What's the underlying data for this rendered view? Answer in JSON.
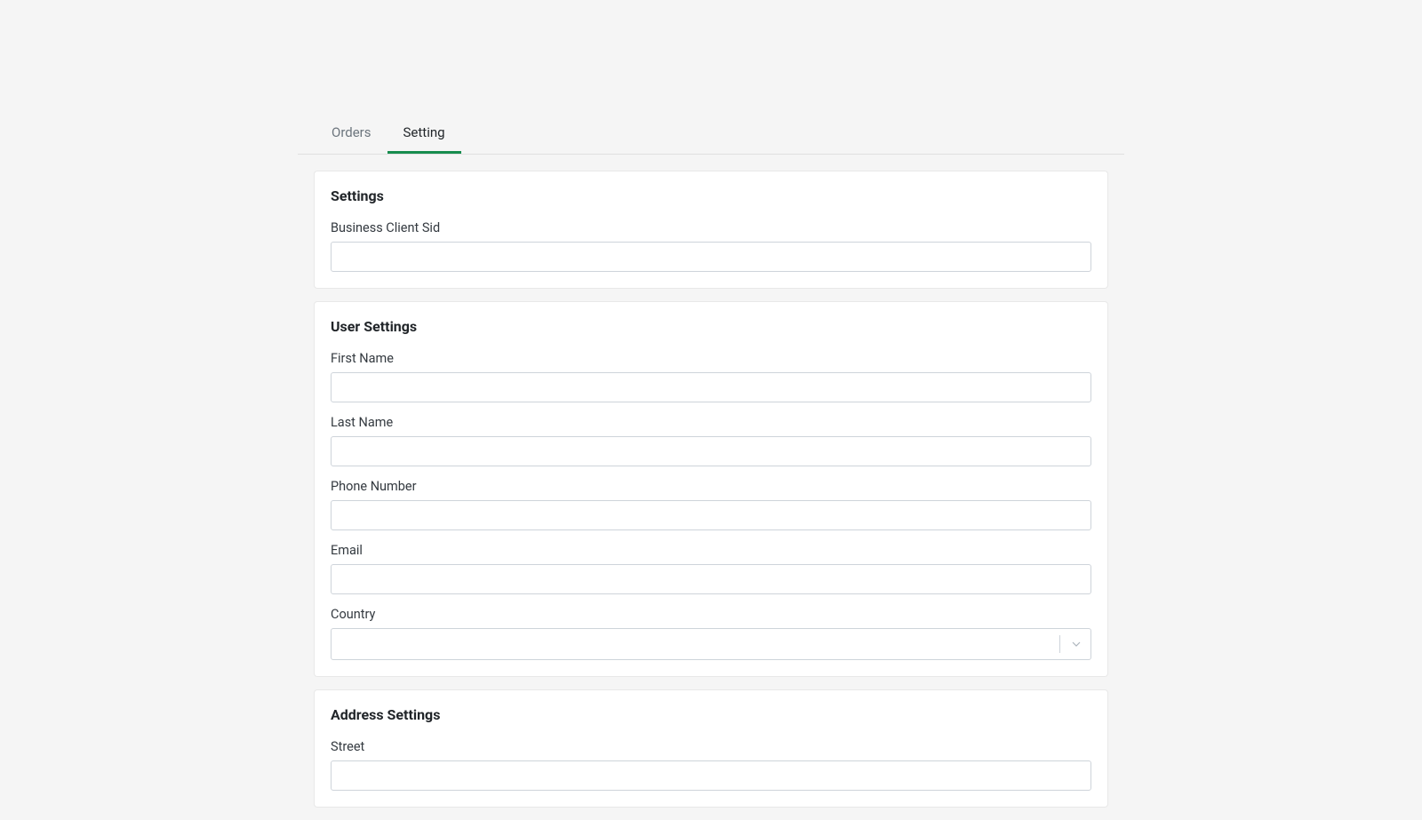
{
  "tabs": {
    "orders": "Orders",
    "setting": "Setting"
  },
  "sections": {
    "settings": {
      "title": "Settings",
      "fields": {
        "business_client_sid": {
          "label": "Business Client Sid",
          "value": ""
        }
      }
    },
    "user_settings": {
      "title": "User Settings",
      "fields": {
        "first_name": {
          "label": "First Name",
          "value": ""
        },
        "last_name": {
          "label": "Last Name",
          "value": ""
        },
        "phone_number": {
          "label": "Phone Number",
          "value": ""
        },
        "email": {
          "label": "Email",
          "value": ""
        },
        "country": {
          "label": "Country",
          "value": ""
        }
      }
    },
    "address_settings": {
      "title": "Address Settings",
      "fields": {
        "street": {
          "label": "Street",
          "value": ""
        }
      }
    }
  },
  "colors": {
    "accent": "#178c4e",
    "background": "#f5f5f5",
    "card_bg": "#ffffff",
    "border": "#ced4da"
  }
}
